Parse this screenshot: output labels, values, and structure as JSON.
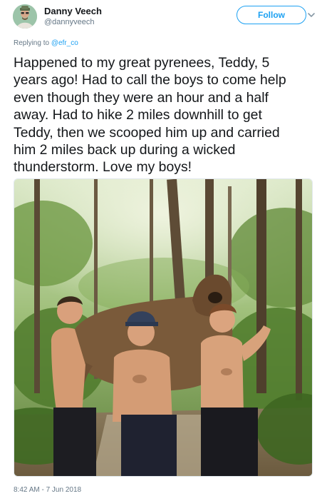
{
  "author": {
    "display_name": "Danny Veech",
    "username": "@dannyveech"
  },
  "follow_label": "Follow",
  "reply": {
    "prefix": "Replying to ",
    "mention": "@efr_co"
  },
  "tweet": {
    "lines": [
      "Happened to my great pyrenees, Teddy, 5",
      "years ago! Had to call the boys to come help",
      "even though they were an hour and a half",
      "away. Had to hike 2 miles downhill to get",
      "Teddy, then we scooped him up and carried",
      "him 2 miles back up during a wicked",
      "thunderstorm. Love my boys!"
    ]
  },
  "timestamp": "8:42 AM - 7 Jun 2018",
  "icons": {
    "avatar": "avatar",
    "caret": "chevron-down-icon"
  },
  "colors": {
    "accent": "#1da1f2",
    "text": "#14171a",
    "muted": "#657786",
    "border": "#e1e8ed"
  }
}
